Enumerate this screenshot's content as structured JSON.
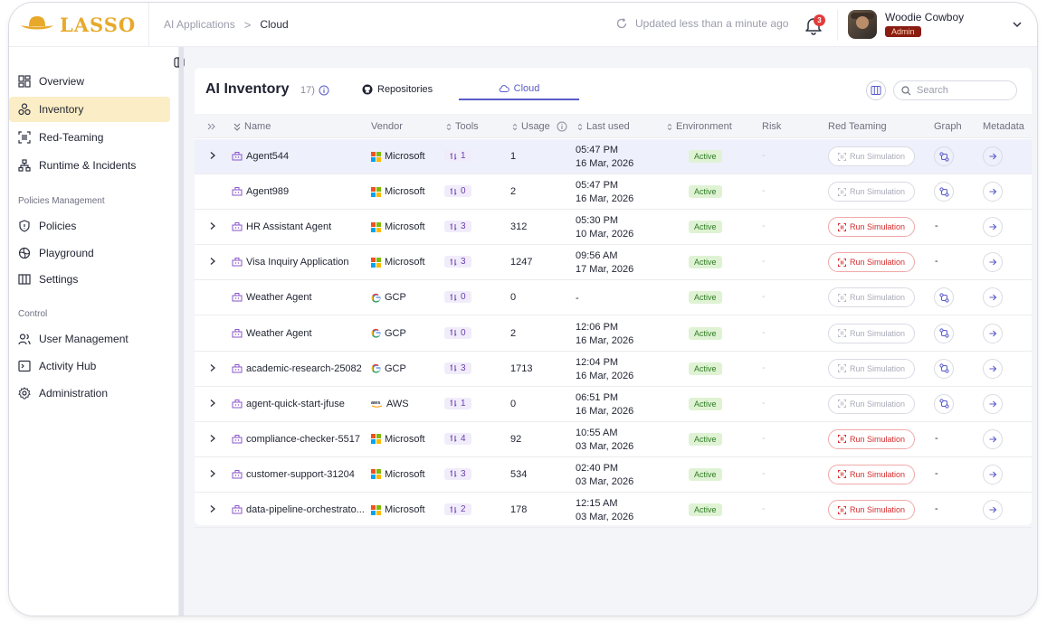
{
  "brand": {
    "name": "LASSO",
    "color": "#e8a92a"
  },
  "breadcrumb": {
    "parent": "AI Applications",
    "separator": ">",
    "current": "Cloud"
  },
  "header": {
    "updated_text": "Updated less than a minute ago",
    "notification_count": "3"
  },
  "user": {
    "name": "Woodie Cowboy",
    "role": "Admin"
  },
  "sidebar": {
    "items": [
      {
        "label": "Overview",
        "icon": "grid-icon"
      },
      {
        "label": "Inventory",
        "icon": "inventory-icon",
        "active": true
      },
      {
        "label": "Red-Teaming",
        "icon": "scan-icon"
      },
      {
        "label": "Runtime & Incidents",
        "icon": "network-icon"
      }
    ],
    "section_policies": "Policies Management",
    "policies_items": [
      {
        "label": "Policies",
        "icon": "shield-icon"
      },
      {
        "label": "Playground",
        "icon": "playground-icon"
      },
      {
        "label": "Settings",
        "icon": "columns-icon"
      }
    ],
    "section_control": "Control",
    "control_items": [
      {
        "label": "User Management",
        "icon": "users-icon"
      },
      {
        "label": "Activity Hub",
        "icon": "terminal-icon"
      },
      {
        "label": "Administration",
        "icon": "gear-icon"
      }
    ]
  },
  "main": {
    "title": "AI Inventory",
    "count": "17)",
    "tabs": [
      {
        "label": "Repositories",
        "icon": "github-icon"
      },
      {
        "label": "Cloud",
        "icon": "cloud-icon",
        "active": true
      }
    ],
    "search_placeholder": "Search"
  },
  "table": {
    "columns": [
      "Name",
      "Vendor",
      "Tools",
      "Usage",
      "Last used",
      "Environment",
      "Risk",
      "Red Teaming",
      "Graph",
      "Metadata"
    ],
    "run_simulation_label": "Run Simulation",
    "rows": [
      {
        "name": "Agent544",
        "vendor": "Microsoft",
        "tools": "1",
        "usage": "1",
        "time": "05:47 PM",
        "date": "16 Mar, 2026",
        "env": "Active",
        "risk": "-",
        "expandable": true,
        "sim_active": false,
        "graph": "icon",
        "highlight": true
      },
      {
        "name": "Agent989",
        "vendor": "Microsoft",
        "tools": "0",
        "usage": "2",
        "time": "05:47 PM",
        "date": "16 Mar, 2026",
        "env": "Active",
        "risk": "-",
        "expandable": false,
        "sim_active": false,
        "graph": "icon"
      },
      {
        "name": "HR Assistant Agent",
        "vendor": "Microsoft",
        "tools": "3",
        "usage": "312",
        "time": "05:30 PM",
        "date": "10 Mar, 2026",
        "env": "Active",
        "risk": "-",
        "expandable": true,
        "sim_active": true,
        "graph": "-"
      },
      {
        "name": "Visa Inquiry Application",
        "vendor": "Microsoft",
        "tools": "3",
        "usage": "1247",
        "time": "09:56 AM",
        "date": "17 Mar, 2026",
        "env": "Active",
        "risk": "-",
        "expandable": true,
        "sim_active": true,
        "graph": "-"
      },
      {
        "name": "Weather Agent",
        "vendor": "GCP",
        "tools": "0",
        "usage": "0",
        "time": "-",
        "date": "",
        "env": "Active",
        "risk": "-",
        "expandable": false,
        "sim_active": false,
        "graph": "icon"
      },
      {
        "name": "Weather Agent",
        "vendor": "GCP",
        "tools": "0",
        "usage": "2",
        "time": "12:06 PM",
        "date": "16 Mar, 2026",
        "env": "Active",
        "risk": "-",
        "expandable": false,
        "sim_active": false,
        "graph": "icon"
      },
      {
        "name": "academic-research-25082",
        "vendor": "GCP",
        "tools": "3",
        "usage": "1713",
        "time": "12:04 PM",
        "date": "16 Mar, 2026",
        "env": "Active",
        "risk": "-",
        "expandable": true,
        "sim_active": false,
        "graph": "icon"
      },
      {
        "name": "agent-quick-start-jfuse",
        "vendor": "AWS",
        "tools": "1",
        "usage": "0",
        "time": "06:51 PM",
        "date": "16 Mar, 2026",
        "env": "Active",
        "risk": "-",
        "expandable": true,
        "sim_active": false,
        "graph": "icon"
      },
      {
        "name": "compliance-checker-5517",
        "vendor": "Microsoft",
        "tools": "4",
        "usage": "92",
        "time": "10:55 AM",
        "date": "03 Mar, 2026",
        "env": "Active",
        "risk": "-",
        "expandable": true,
        "sim_active": true,
        "graph": "-"
      },
      {
        "name": "customer-support-31204",
        "vendor": "Microsoft",
        "tools": "3",
        "usage": "534",
        "time": "02:40 PM",
        "date": "03 Mar, 2026",
        "env": "Active",
        "risk": "-",
        "expandable": true,
        "sim_active": true,
        "graph": "-"
      },
      {
        "name": "data-pipeline-orchestrato...",
        "vendor": "Microsoft",
        "tools": "2",
        "usage": "178",
        "time": "12:15 AM",
        "date": "03 Mar, 2026",
        "env": "Active",
        "risk": "-",
        "expandable": true,
        "sim_active": true,
        "graph": "-"
      }
    ]
  }
}
